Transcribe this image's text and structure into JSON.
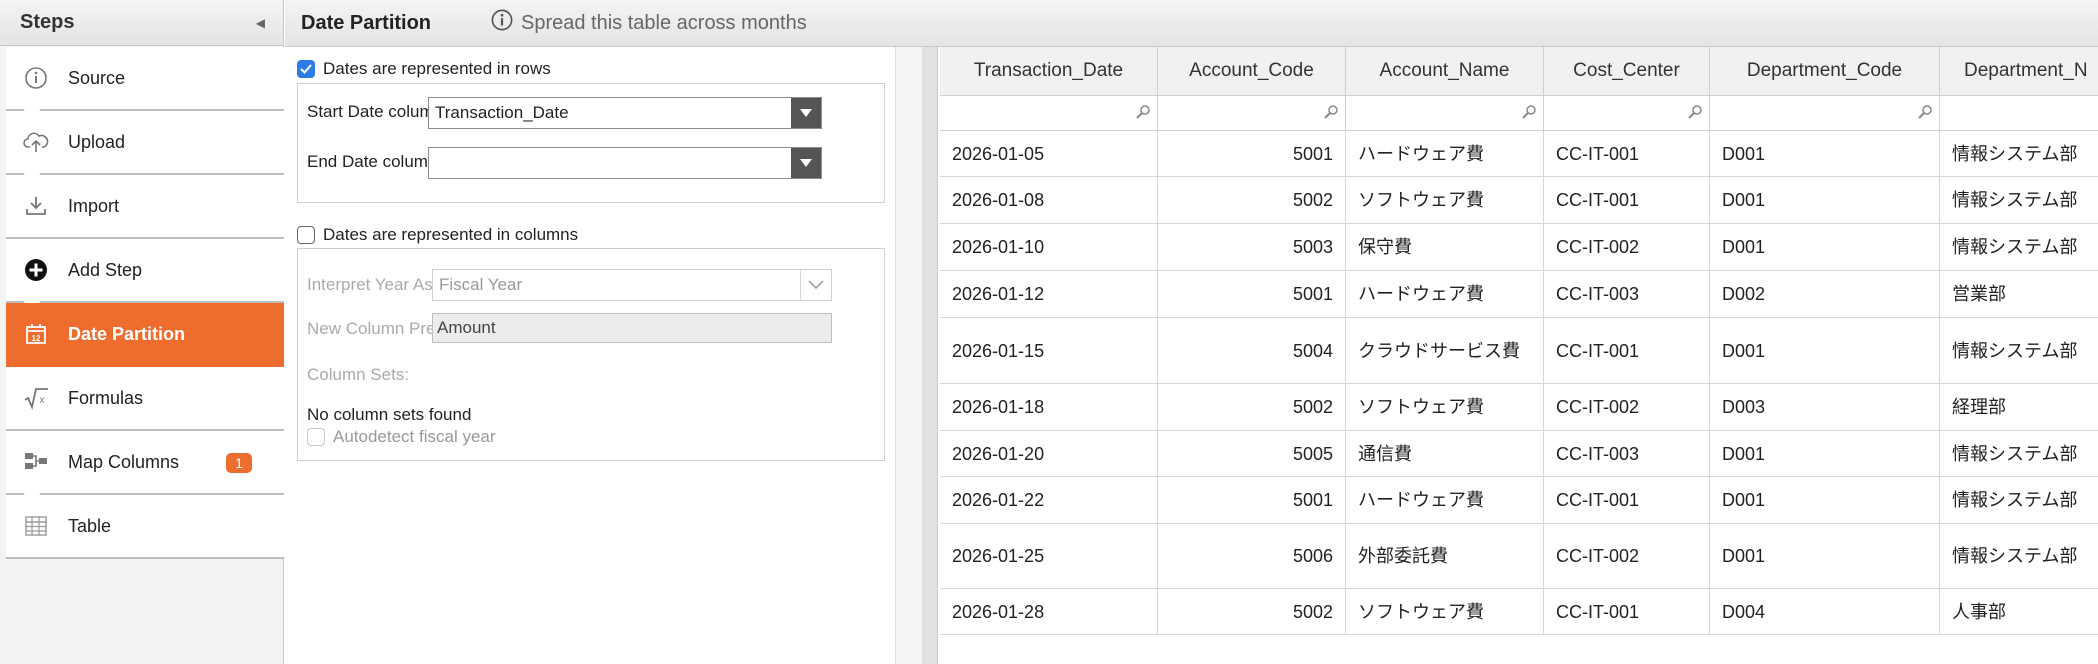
{
  "sidebar": {
    "title": "Steps",
    "steps": [
      {
        "label": "Source",
        "icon": "info-icon"
      },
      {
        "label": "Upload",
        "icon": "cloud-upload-icon"
      },
      {
        "label": "Import",
        "icon": "download-tray-icon"
      },
      {
        "label": "Add Step",
        "icon": "add-circle-icon"
      },
      {
        "label": "Date Partition",
        "icon": "calendar-icon"
      },
      {
        "label": "Formulas",
        "icon": "square-root-icon"
      },
      {
        "label": "Map Columns",
        "icon": "map-columns-icon",
        "badge": "1"
      },
      {
        "label": "Table",
        "icon": "table-grid-icon"
      }
    ],
    "active_step": "Date Partition"
  },
  "header": {
    "title": "Date Partition",
    "hint": "Spread this table across months"
  },
  "config": {
    "rows_option": {
      "label": "Dates are represented in rows",
      "checked": true
    },
    "start_date": {
      "label": "Start Date column:",
      "value": "Transaction_Date"
    },
    "end_date": {
      "label": "End Date column:",
      "value": ""
    },
    "columns_option": {
      "label": "Dates are represented in columns",
      "checked": false
    },
    "interpret_year": {
      "label": "Interpret Year As:",
      "value": "Fiscal Year"
    },
    "column_prefix": {
      "label": "New Column Prefix:",
      "value": "Amount"
    },
    "column_sets": {
      "label": "Column Sets:",
      "empty_text": "No column sets found"
    },
    "autodetect": {
      "label": "Autodetect fiscal year",
      "checked": false
    }
  },
  "table": {
    "columns": [
      "Transaction_Date",
      "Account_Code",
      "Account_Name",
      "Cost_Center",
      "Department_Code",
      "Department_N"
    ],
    "rows": [
      [
        "2026-01-05",
        "5001",
        "ハードウェア費",
        "CC-IT-001",
        "D001",
        "情報システム部"
      ],
      [
        "2026-01-08",
        "5002",
        "ソフトウェア費",
        "CC-IT-001",
        "D001",
        "情報システム部"
      ],
      [
        "2026-01-10",
        "5003",
        "保守費",
        "CC-IT-002",
        "D001",
        "情報システム部"
      ],
      [
        "2026-01-12",
        "5001",
        "ハードウェア費",
        "CC-IT-003",
        "D002",
        "営業部"
      ],
      [
        "2026-01-15",
        "5004",
        "クラウドサービス費",
        "CC-IT-001",
        "D001",
        "情報システム部"
      ],
      [
        "2026-01-18",
        "5002",
        "ソフトウェア費",
        "CC-IT-002",
        "D003",
        "経理部"
      ],
      [
        "2026-01-20",
        "5005",
        "通信費",
        "CC-IT-003",
        "D001",
        "情報システム部"
      ],
      [
        "2026-01-22",
        "5001",
        "ハードウェア費",
        "CC-IT-001",
        "D001",
        "情報システム部"
      ],
      [
        "2026-01-25",
        "5006",
        "外部委託費",
        "CC-IT-002",
        "D001",
        "情報システム部"
      ],
      [
        "2026-01-28",
        "5002",
        "ソフトウェア費",
        "CC-IT-001",
        "D004",
        "人事部"
      ]
    ]
  },
  "colors": {
    "accent": "#ee6d2e",
    "checkbox": "#2d7be5"
  }
}
